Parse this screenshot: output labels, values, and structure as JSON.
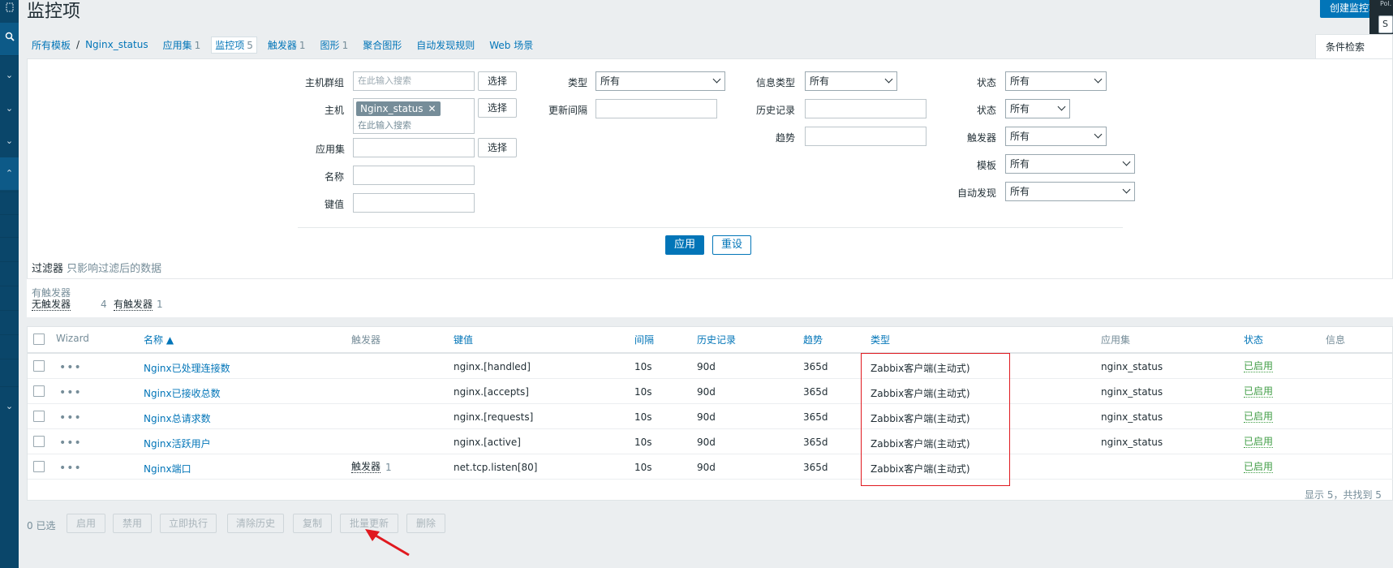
{
  "page": {
    "title": "监控项",
    "create_button": "创建监控项",
    "corner_text": "Pol.",
    "corner_box": "S"
  },
  "sidebar": {
    "icons": [
      "window-icon",
      "search-icon",
      "chevron-down-icon",
      "chevron-down-icon",
      "chevron-down-icon",
      "chevron-up-icon",
      "chevron-down-icon"
    ]
  },
  "breadcrumb": {
    "all_templates": "所有模板",
    "separator": "/",
    "template": "Nginx_status",
    "tabs": [
      {
        "label": "应用集",
        "count": "1"
      },
      {
        "label": "监控项",
        "count": "5"
      },
      {
        "label": "触发器",
        "count": "1"
      },
      {
        "label": "图形",
        "count": "1"
      },
      {
        "label": "聚合图形",
        "count": ""
      },
      {
        "label": "自动发现规则",
        "count": ""
      },
      {
        "label": "Web 场景",
        "count": ""
      }
    ]
  },
  "filter": {
    "tab_label": "条件检索",
    "host_group_label": "主机群组",
    "host_group_placeholder": "在此输入搜索",
    "select_label": "选择",
    "host_label": "主机",
    "host_tag": "Nginx_status",
    "host_placeholder": "在此输入搜索",
    "appset_label": "应用集",
    "name_label": "名称",
    "key_label": "键值",
    "type_label": "类型",
    "type_value": "所有",
    "interval_label": "更新间隔",
    "info_type_label": "信息类型",
    "info_type_value": "所有",
    "history_label": "历史记录",
    "trend_label": "趋势",
    "status_label": "状态",
    "status_value": "所有",
    "status2_label": "状态",
    "status2_value": "所有",
    "trigger_label": "触发器",
    "trigger_value": "所有",
    "template_label": "模板",
    "template_value": "所有",
    "discovery_label": "自动发现",
    "discovery_value": "所有",
    "apply": "应用",
    "reset": "重设"
  },
  "filter_note": {
    "title": "过滤器",
    "hint": "只影响过滤后的数据"
  },
  "subfilter": {
    "title": "有触发器",
    "options": [
      {
        "label": "无触发器",
        "count": "4"
      },
      {
        "label": "有触发器",
        "count": "1"
      }
    ]
  },
  "table": {
    "headers": {
      "wizard": "Wizard",
      "name": "名称 ▲",
      "triggers": "触发器",
      "key": "键值",
      "interval": "间隔",
      "history": "历史记录",
      "trends": "趋势",
      "type": "类型",
      "applications": "应用集",
      "status": "状态",
      "info": "信息"
    },
    "rows": [
      {
        "name": "Nginx已处理连接数",
        "trigger": "",
        "trigger_count": "",
        "key": "nginx.[handled]",
        "interval": "10s",
        "history": "90d",
        "trends": "365d",
        "type": "Zabbix客户端(主动式)",
        "app": "nginx_status",
        "status": "已启用"
      },
      {
        "name": "Nginx已接收总数",
        "trigger": "",
        "trigger_count": "",
        "key": "nginx.[accepts]",
        "interval": "10s",
        "history": "90d",
        "trends": "365d",
        "type": "Zabbix客户端(主动式)",
        "app": "nginx_status",
        "status": "已启用"
      },
      {
        "name": "Nginx总请求数",
        "trigger": "",
        "trigger_count": "",
        "key": "nginx.[requests]",
        "interval": "10s",
        "history": "90d",
        "trends": "365d",
        "type": "Zabbix客户端(主动式)",
        "app": "nginx_status",
        "status": "已启用"
      },
      {
        "name": "Nginx活跃用户",
        "trigger": "",
        "trigger_count": "",
        "key": "nginx.[active]",
        "interval": "10s",
        "history": "90d",
        "trends": "365d",
        "type": "Zabbix客户端(主动式)",
        "app": "nginx_status",
        "status": "已启用"
      },
      {
        "name": "Nginx端口",
        "trigger": "触发器",
        "trigger_count": "1",
        "key": "net.tcp.listen[80]",
        "interval": "10s",
        "history": "90d",
        "trends": "365d",
        "type": "Zabbix客户端(主动式)",
        "app": "",
        "status": "已启用"
      }
    ],
    "footer": "显示 5，共找到 5"
  },
  "actions": {
    "selected": "0 已选",
    "buttons": [
      "启用",
      "禁用",
      "立即执行",
      "清除历史",
      "复制",
      "批量更新",
      "删除"
    ]
  },
  "colors": {
    "accent": "#0275b8",
    "sidebar": "#0a466a",
    "enabled": "#429e47",
    "highlight": "#e0191f"
  }
}
